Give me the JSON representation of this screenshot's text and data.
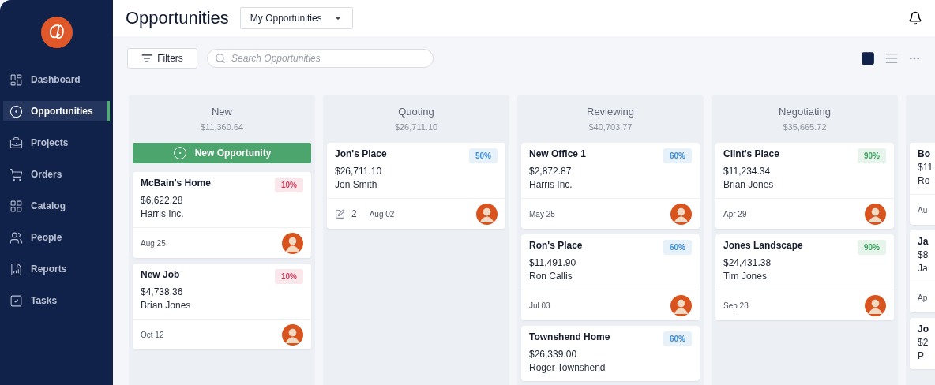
{
  "sidebar": {
    "items": [
      {
        "label": "Dashboard",
        "selected": false
      },
      {
        "label": "Opportunities",
        "selected": true
      },
      {
        "label": "Projects",
        "selected": false
      },
      {
        "label": "Orders",
        "selected": false
      },
      {
        "label": "Catalog",
        "selected": false
      },
      {
        "label": "People",
        "selected": false
      },
      {
        "label": "Reports",
        "selected": false
      },
      {
        "label": "Tasks",
        "selected": false
      }
    ]
  },
  "header": {
    "title": "Opportunities",
    "view_select": "My Opportunities"
  },
  "toolbar": {
    "filters_label": "Filters",
    "search": {
      "placeholder": "Search Opportunities"
    },
    "views": [
      {
        "kind": "board",
        "selected": true
      },
      {
        "kind": "list",
        "selected": false
      }
    ]
  },
  "columns": [
    {
      "name": "New",
      "total": "$11,360.64",
      "add_label": "New Opportunity",
      "cards": [
        {
          "title": "McBain's Home",
          "probability": "10%",
          "color": "#d23c5c",
          "amount": "$6,622.28",
          "contact": "Harris Inc.",
          "date": "Aug 25"
        },
        {
          "title": "New Job",
          "probability": "10%",
          "color": "#d23c5c",
          "amount": "$4,738.36",
          "contact": "Brian Jones",
          "date": "Oct 12"
        }
      ]
    },
    {
      "name": "Quoting",
      "total": "$26,711.10",
      "cards": [
        {
          "title": "Jon's Place",
          "probability": "50%",
          "color": "#3c8fd8",
          "amount": "$26,711.10",
          "contact": "Jon Smith",
          "tasks": "2",
          "date": "Aug 02"
        }
      ]
    },
    {
      "name": "Reviewing",
      "total": "$40,703.77",
      "cards": [
        {
          "title": "New Office 1",
          "probability": "60%",
          "color": "#3c8fd8",
          "amount": "$2,872.87",
          "contact": "Harris Inc.",
          "date": "May 25"
        },
        {
          "title": "Ron's Place",
          "probability": "60%",
          "color": "#3c8fd8",
          "amount": "$11,491.90",
          "contact": "Ron Callis",
          "date": "Jul 03"
        },
        {
          "title": "Townshend Home",
          "probability": "60%",
          "color": "#3c8fd8",
          "amount": "$26,339.00",
          "contact": "Roger Townshend"
        }
      ]
    },
    {
      "name": "Negotiating",
      "total": "$35,665.72",
      "cards": [
        {
          "title": "Clint's Place",
          "probability": "90%",
          "color": "#3aa35e",
          "amount": "$11,234.34",
          "contact": "Brian Jones",
          "date": "Apr 29"
        },
        {
          "title": "Jones Landscape",
          "probability": "90%",
          "color": "#3aa35e",
          "amount": "$24,431.38",
          "contact": "Tim Jones",
          "date": "Sep 28"
        }
      ]
    },
    {
      "cards": [
        {
          "title": "Bo",
          "amount": "$11",
          "contact": "Ro",
          "date": "Au"
        },
        {
          "title": "Ja",
          "amount": "$8",
          "contact": "Ja",
          "date": "Ap"
        },
        {
          "title": "Jo",
          "amount": "$2",
          "contact": "P"
        }
      ]
    }
  ]
}
